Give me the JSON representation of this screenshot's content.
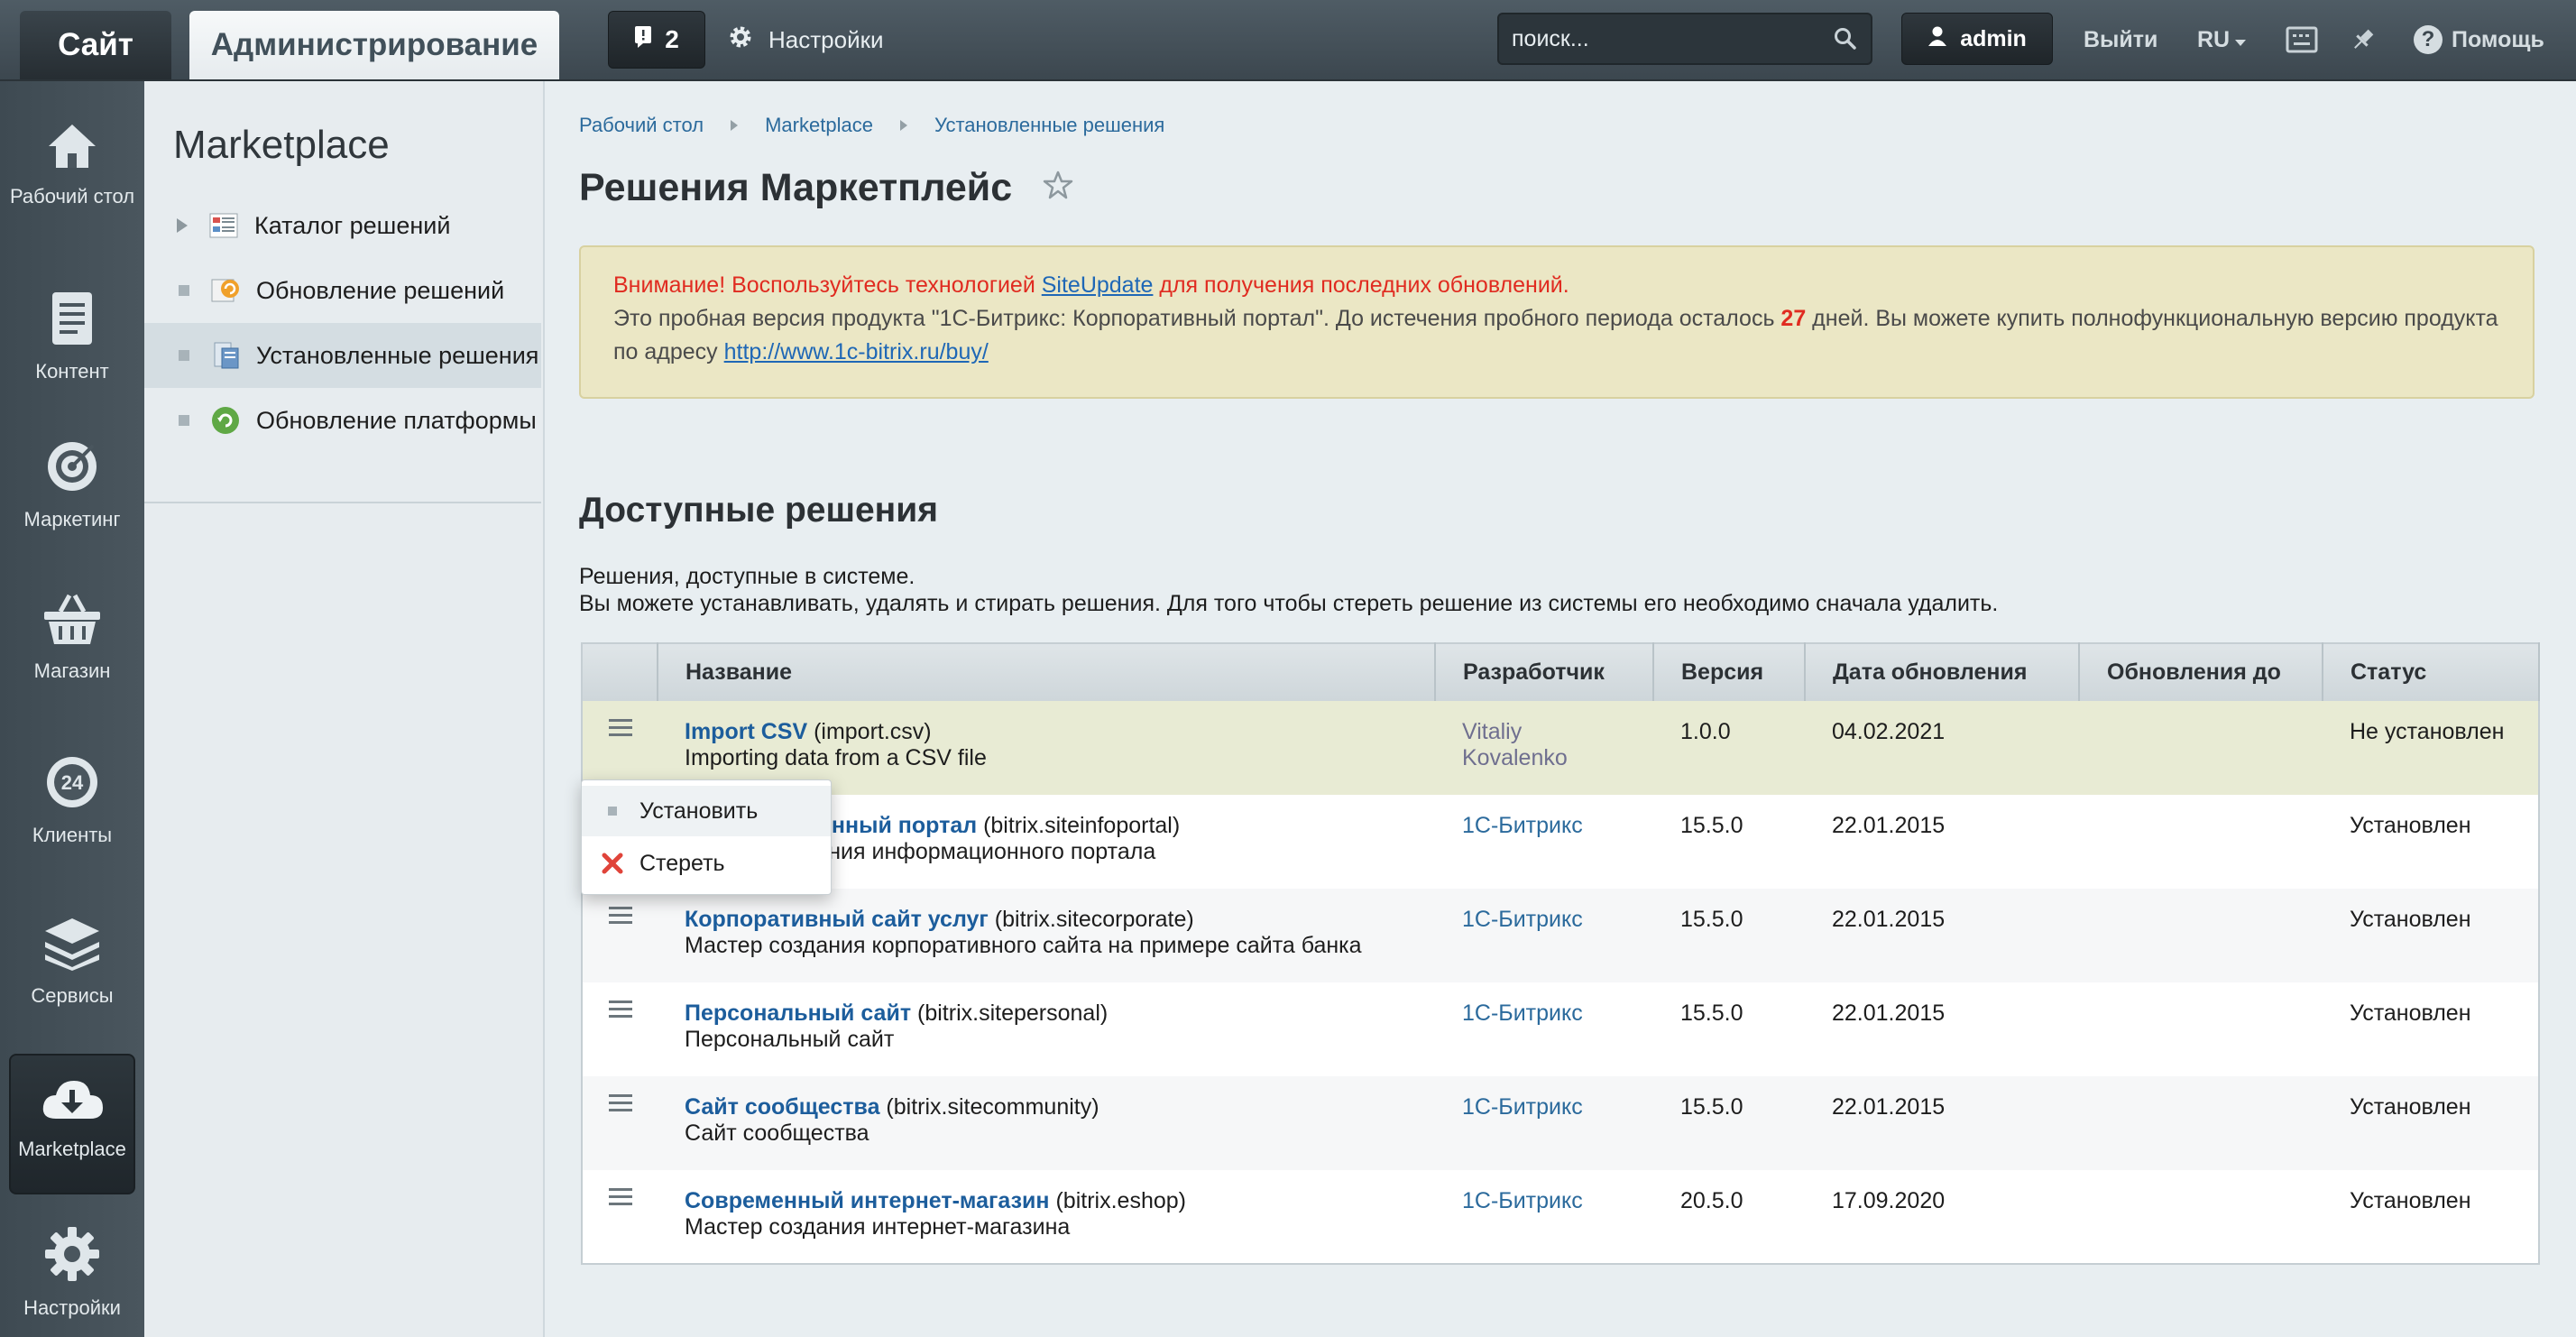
{
  "topbar": {
    "site_tab": "Сайт",
    "admin_tab": "Администрирование",
    "notifications_count": "2",
    "settings_label": "Настройки",
    "search_placeholder": "поиск...",
    "user_name": "admin",
    "logout_label": "Выйти",
    "language": "RU",
    "help_label": "Помощь"
  },
  "main_menu": [
    {
      "label": "Рабочий стол",
      "icon": "home-icon"
    },
    {
      "label": "Контент",
      "icon": "document-icon"
    },
    {
      "label": "Маркетинг",
      "icon": "target-icon"
    },
    {
      "label": "Магазин",
      "icon": "basket-icon"
    },
    {
      "label": "Клиенты",
      "icon": "clients-24-icon"
    },
    {
      "label": "Сервисы",
      "icon": "layers-icon"
    },
    {
      "label": "Marketplace",
      "icon": "cloud-download-icon",
      "active": true
    },
    {
      "label": "Настройки",
      "icon": "gear-icon"
    }
  ],
  "submenu": {
    "title": "Marketplace",
    "items": [
      {
        "label": "Каталог решений",
        "icon": "catalog-icon"
      },
      {
        "label": "Обновление решений",
        "icon": "update-solutions-icon"
      },
      {
        "label": "Установленные решения",
        "icon": "installed-icon",
        "active": true
      },
      {
        "label": "Обновление платформы",
        "icon": "platform-update-icon"
      }
    ]
  },
  "breadcrumb": [
    "Рабочий стол",
    "Marketplace",
    "Установленные решения"
  ],
  "page_title": "Решения Маркетплейс",
  "notice": {
    "warn_prefix": "Внимание! Воспользуйтесь технологией ",
    "warn_link": "SiteUpdate",
    "warn_suffix": " для получения последних обновлений.",
    "trial_prefix": "Это пробная версия продукта \"1С-Битрикс: Корпоративный портал\". До истечения пробного периода осталось ",
    "trial_days": "27",
    "trial_suffix": " дней. Вы можете купить полнофункциональную версию продукта по адресу ",
    "buy_link": "http://www.1c-bitrix.ru/buy/"
  },
  "section": {
    "title": "Доступные решения",
    "desc_line1": "Решения, доступные в системе.",
    "desc_line2": "Вы можете устанавливать, удалять и стирать решения. Для того чтобы стереть решение из системы его необходимо сначала удалить."
  },
  "table": {
    "columns": [
      "Название",
      "Разработчик",
      "Версия",
      "Дата обновления",
      "Обновления до",
      "Статус"
    ],
    "rows": [
      {
        "name": "Import CSV",
        "code": "(import.csv)",
        "desc": "Importing data from a CSV file",
        "developer": "Vitaliy Kovalenko",
        "version": "1.0.0",
        "date": "04.02.2021",
        "updates_until": "",
        "status": "Не установлен"
      },
      {
        "name": "Информационный портал",
        "code": "(bitrix.siteinfoportal)",
        "desc": "Мастер создания информационного портала",
        "developer": "1С-Битрикс",
        "version": "15.5.0",
        "date": "22.01.2015",
        "updates_until": "",
        "status": "Установлен"
      },
      {
        "name": "Корпоративный сайт услуг",
        "code": "(bitrix.sitecorporate)",
        "desc": "Мастер создания корпоративного сайта на примере сайта банка",
        "developer": "1С-Битрикс",
        "version": "15.5.0",
        "date": "22.01.2015",
        "updates_until": "",
        "status": "Установлен"
      },
      {
        "name": "Персональный сайт",
        "code": "(bitrix.sitepersonal)",
        "desc": "Персональный сайт",
        "developer": "1С-Битрикс",
        "version": "15.5.0",
        "date": "22.01.2015",
        "updates_until": "",
        "status": "Установлен"
      },
      {
        "name": "Сайт сообщества",
        "code": "(bitrix.sitecommunity)",
        "desc": "Сайт сообщества",
        "developer": "1С-Битрикс",
        "version": "15.5.0",
        "date": "22.01.2015",
        "updates_until": "",
        "status": "Установлен"
      },
      {
        "name": "Современный интернет-магазин",
        "code": "(bitrix.eshop)",
        "desc": "Мастер создания интернет-магазина",
        "developer": "1С-Битрикс",
        "version": "20.5.0",
        "date": "17.09.2020",
        "updates_until": "",
        "status": "Установлен"
      }
    ]
  },
  "context_menu": {
    "install_label": "Установить",
    "erase_label": "Стереть"
  },
  "colors": {
    "accent_link": "#1c5d9c",
    "status_not_installed": "#e02b20",
    "notice_bg": "#ebe7c5"
  }
}
